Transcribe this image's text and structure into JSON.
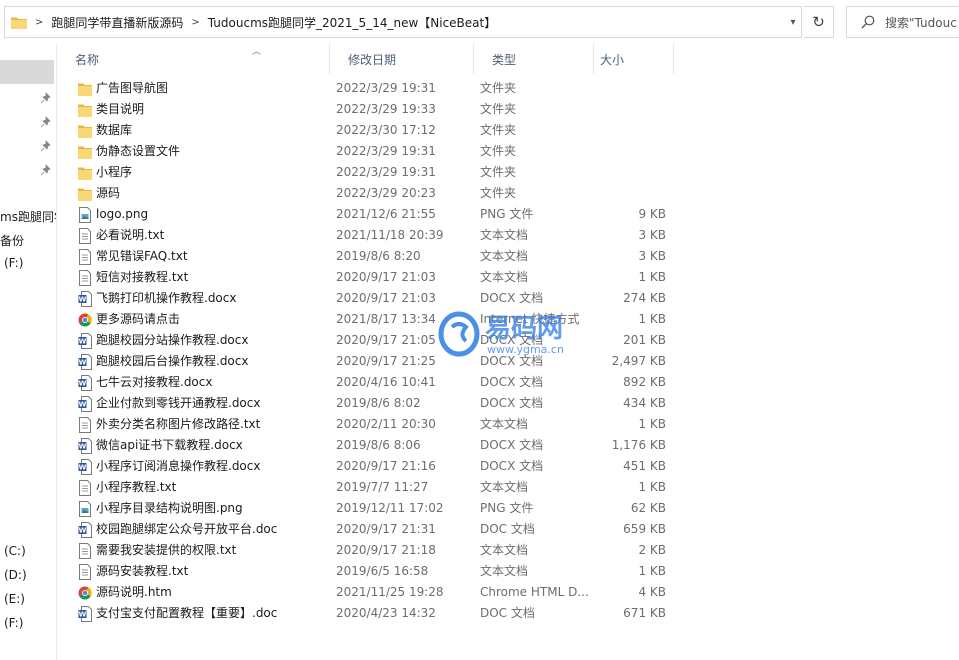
{
  "address": {
    "crumbs": [
      "跑腿同学带直播新版源码",
      "Tudoucms跑腿同学_2021_5_14_new【NiceBeat】"
    ],
    "separator": ">"
  },
  "search": {
    "placeholder": "搜索\"Tudouc"
  },
  "nav": {
    "items": [
      "ms跑腿同学",
      "备份",
      "(F:)",
      "(C:)",
      "(D:)",
      "(E:)",
      "(F:)"
    ]
  },
  "columns": {
    "name": "名称",
    "date": "修改日期",
    "type": "类型",
    "size": "大小"
  },
  "files": [
    {
      "name": "广告图导航图",
      "date": "2022/3/29 19:31",
      "type": "文件夹",
      "size": "",
      "icon": "folder-icon"
    },
    {
      "name": "类目说明",
      "date": "2022/3/29 19:33",
      "type": "文件夹",
      "size": "",
      "icon": "folder-icon"
    },
    {
      "name": "数据库",
      "date": "2022/3/30 17:12",
      "type": "文件夹",
      "size": "",
      "icon": "folder-icon"
    },
    {
      "name": "伪静态设置文件",
      "date": "2022/3/29 19:31",
      "type": "文件夹",
      "size": "",
      "icon": "folder-icon"
    },
    {
      "name": "小程序",
      "date": "2022/3/29 19:31",
      "type": "文件夹",
      "size": "",
      "icon": "folder-icon"
    },
    {
      "name": "源码",
      "date": "2022/3/29 20:23",
      "type": "文件夹",
      "size": "",
      "icon": "folder-icon"
    },
    {
      "name": "logo.png",
      "date": "2021/12/6 21:55",
      "type": "PNG 文件",
      "size": "9 KB",
      "icon": "image-file-icon"
    },
    {
      "name": "必看说明.txt",
      "date": "2021/11/18 20:39",
      "type": "文本文档",
      "size": "3 KB",
      "icon": "text-file-icon"
    },
    {
      "name": "常见错误FAQ.txt",
      "date": "2019/8/6 8:20",
      "type": "文本文档",
      "size": "3 KB",
      "icon": "text-file-icon"
    },
    {
      "name": "短信对接教程.txt",
      "date": "2020/9/17 21:03",
      "type": "文本文档",
      "size": "1 KB",
      "icon": "text-file-icon"
    },
    {
      "name": "飞鹅打印机操作教程.docx",
      "date": "2020/9/17 21:03",
      "type": "DOCX 文档",
      "size": "274 KB",
      "icon": "word-file-icon"
    },
    {
      "name": "更多源码请点击",
      "date": "2021/8/17 13:34",
      "type": "Internet 快捷方式",
      "size": "1 KB",
      "icon": "chrome-icon"
    },
    {
      "name": "跑腿校园分站操作教程.docx",
      "date": "2020/9/17 21:05",
      "type": "DOCX 文档",
      "size": "201 KB",
      "icon": "word-file-icon"
    },
    {
      "name": "跑腿校园后台操作教程.docx",
      "date": "2020/9/17 21:25",
      "type": "DOCX 文档",
      "size": "2,497 KB",
      "icon": "word-file-icon"
    },
    {
      "name": "七牛云对接教程.docx",
      "date": "2020/4/16 10:41",
      "type": "DOCX 文档",
      "size": "892 KB",
      "icon": "word-file-icon"
    },
    {
      "name": "企业付款到零钱开通教程.docx",
      "date": "2019/8/6 8:02",
      "type": "DOCX 文档",
      "size": "434 KB",
      "icon": "word-file-icon"
    },
    {
      "name": "外卖分类名称图片修改路径.txt",
      "date": "2020/2/11 20:30",
      "type": "文本文档",
      "size": "1 KB",
      "icon": "text-file-icon"
    },
    {
      "name": "微信api证书下载教程.docx",
      "date": "2019/8/6 8:06",
      "type": "DOCX 文档",
      "size": "1,176 KB",
      "icon": "word-file-icon"
    },
    {
      "name": "小程序订阅消息操作教程.docx",
      "date": "2020/9/17 21:16",
      "type": "DOCX 文档",
      "size": "451 KB",
      "icon": "word-file-icon"
    },
    {
      "name": "小程序教程.txt",
      "date": "2019/7/7 11:27",
      "type": "文本文档",
      "size": "1 KB",
      "icon": "text-file-icon"
    },
    {
      "name": "小程序目录结构说明图.png",
      "date": "2019/12/11 17:02",
      "type": "PNG 文件",
      "size": "62 KB",
      "icon": "image-file-icon"
    },
    {
      "name": "校园跑腿绑定公众号开放平台.doc",
      "date": "2020/9/17 21:31",
      "type": "DOC 文档",
      "size": "659 KB",
      "icon": "word-file-icon"
    },
    {
      "name": "需要我安装提供的权限.txt",
      "date": "2020/9/17 21:18",
      "type": "文本文档",
      "size": "2 KB",
      "icon": "text-file-icon"
    },
    {
      "name": "源码安装教程.txt",
      "date": "2019/6/5 16:58",
      "type": "文本文档",
      "size": "1 KB",
      "icon": "text-file-icon"
    },
    {
      "name": "源码说明.htm",
      "date": "2021/11/25 19:28",
      "type": "Chrome HTML D...",
      "size": "4 KB",
      "icon": "chrome-icon"
    },
    {
      "name": "支付宝支付配置教程【重要】.doc",
      "date": "2020/4/23 14:32",
      "type": "DOC 文档",
      "size": "671 KB",
      "icon": "word-file-icon"
    }
  ],
  "watermark": {
    "title": "易码网",
    "url": "www.ygma.cn"
  },
  "colors": {
    "folder": "#f8d775",
    "accent": "#2b6fd6",
    "word": "#2b579a",
    "watermark": "#2d7be5"
  }
}
